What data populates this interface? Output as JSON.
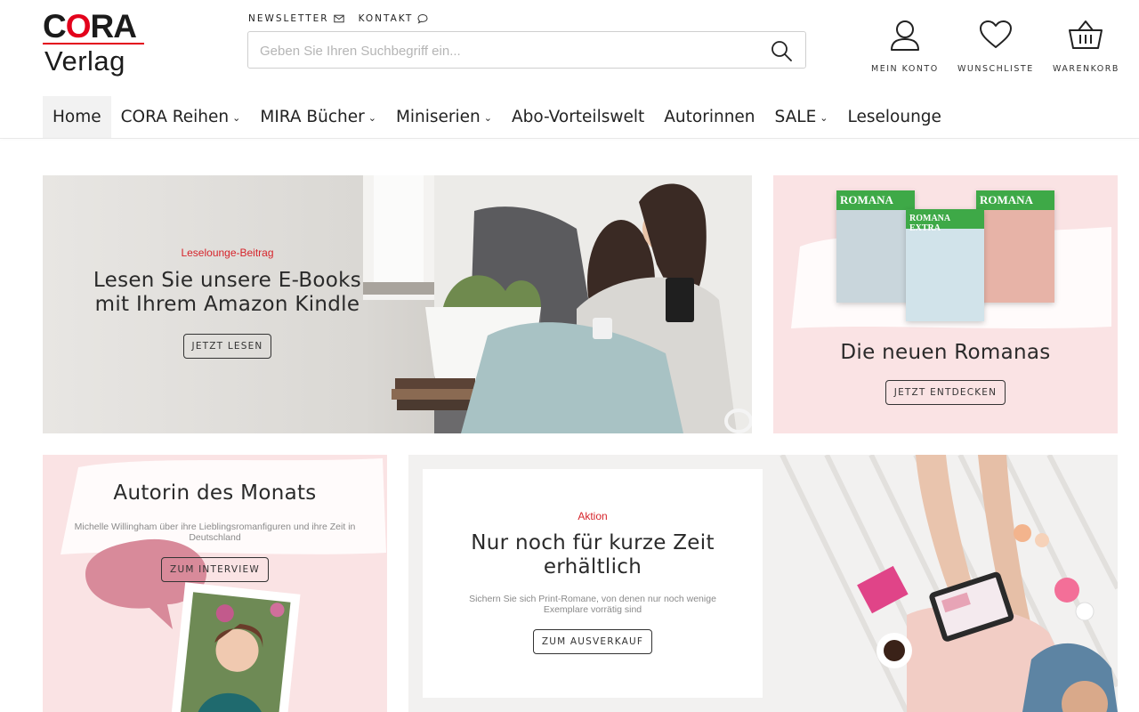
{
  "brand": {
    "logo_top": "CORA",
    "logo_bottom": "Verlag",
    "accent": "#e3001b"
  },
  "toplinks": [
    {
      "label": "NEWSLETTER",
      "icon": "envelope-icon"
    },
    {
      "label": "KONTAKT",
      "icon": "chat-bubble-icon"
    }
  ],
  "search": {
    "placeholder": "Geben Sie Ihren Suchbegriff ein...",
    "value": ""
  },
  "account_nav": [
    {
      "label": "MEIN KONTO",
      "icon": "user-icon"
    },
    {
      "label": "WUNSCHLISTE",
      "icon": "heart-icon"
    },
    {
      "label": "WARENKORB",
      "icon": "basket-icon"
    }
  ],
  "main_nav": [
    {
      "label": "Home",
      "active": true,
      "dropdown": false
    },
    {
      "label": "CORA Reihen",
      "dropdown": true
    },
    {
      "label": "MIRA Bücher",
      "dropdown": true
    },
    {
      "label": "Miniserien",
      "dropdown": true
    },
    {
      "label": "Abo-Vorteilswelt",
      "dropdown": false
    },
    {
      "label": "Autorinnen",
      "dropdown": false
    },
    {
      "label": "SALE",
      "dropdown": true
    },
    {
      "label": "Leselounge",
      "dropdown": false
    }
  ],
  "tiles": {
    "kindle": {
      "kicker": "Leselounge-Beitrag",
      "title": "Lesen Sie unsere E-Books mit Ihrem Amazon Kindle",
      "cta": "JETZT LESEN"
    },
    "romana": {
      "book_labels": [
        "ROMANA",
        "ROMANA EXTRA",
        "ROMANA"
      ],
      "title": "Die neuen Romanas",
      "cta": "JETZT ENTDECKEN"
    },
    "autorin": {
      "title": "Autorin des Monats",
      "desc": "Michelle Willingham über ihre Lieblingsromanfiguren und ihre Zeit in Deutschland",
      "cta": "ZUM INTERVIEW"
    },
    "aktion": {
      "kicker": "Aktion",
      "title": "Nur noch für kurze Zeit erhältlich",
      "desc": "Sichern Sie sich Print-Romane, von denen nur noch wenige Exemplare vorrätig sind",
      "cta": "ZUM AUSVERKAUF"
    }
  },
  "colors": {
    "pink_tile": "#fae3e4",
    "kicker_red": "#d6242b",
    "romana_green": "#3ea947"
  }
}
